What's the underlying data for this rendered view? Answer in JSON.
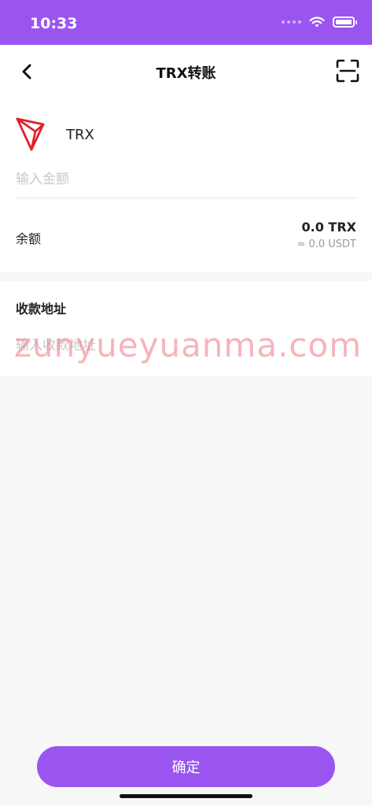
{
  "status_bar": {
    "time": "10:33",
    "icons": [
      "signal-icon",
      "wifi-icon",
      "battery-icon"
    ]
  },
  "nav": {
    "title": "TRX转账",
    "back_icon": "chevron-left-icon",
    "scan_icon": "scan-icon"
  },
  "token": {
    "name": "TRX",
    "logo_icon": "tron-logo-icon",
    "logo_color": "#e0202a"
  },
  "amount": {
    "placeholder": "输入金额",
    "value": ""
  },
  "balance": {
    "label": "余额",
    "value": "0.0 TRX",
    "usdt": "≈ 0.0 USDT"
  },
  "address": {
    "label": "收款地址",
    "placeholder": "输入收款地址",
    "value": ""
  },
  "watermark": "zunyueyuanma.com",
  "confirm_button": "确定",
  "colors": {
    "accent": "#9a55f0",
    "background": "#f7f7f8"
  }
}
